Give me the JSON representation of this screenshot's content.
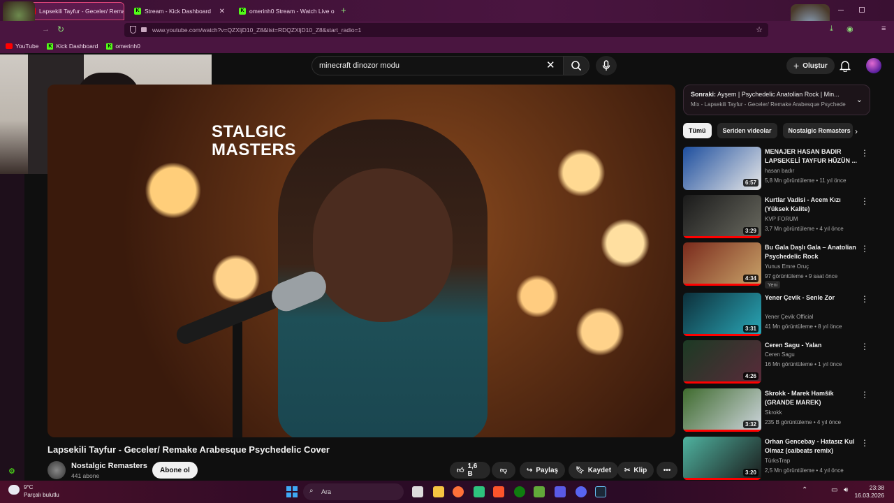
{
  "browser": {
    "tabs": [
      {
        "label": "Lapsekili Tayfur - Geceler/ Remake",
        "close": "✕",
        "favicon_color": "#ff0000"
      },
      {
        "label": "Stream - Kick Dashboard",
        "close": "✕",
        "favicon_color": "#53fc18"
      },
      {
        "label": "omerinh0 Stream - Watch Live o",
        "close": "✕",
        "favicon_color": "#53fc18"
      }
    ],
    "new_tab": "+",
    "url": "www.youtube.com/watch?v=QZXljD10_Z8&list=RDQZXljD10_Z8&start_radio=1",
    "bookmarks": [
      "YouTube",
      "Kick Dashboard",
      "omerinh0"
    ]
  },
  "header": {
    "search_value": "minecraft dinozor modu",
    "create_label": "Oluştur"
  },
  "video": {
    "overlay_line1": "STALGIC",
    "overlay_line2": "MASTERS",
    "title": "Lapsekili Tayfur - Geceler/ Remake Arabesque Psychedelic Cover"
  },
  "channel": {
    "name": "Nostalgic Remasters",
    "subs": "441 abone",
    "subscribe_label": "Abone ol"
  },
  "actions": {
    "likes": "1,6 B",
    "share": "Paylaş",
    "save": "Kaydet",
    "clip": "Klip",
    "more": "•••"
  },
  "up_next": {
    "prefix": "Sonraki:",
    "title": "Ayşem | Psychedelic Anatolian Rock | Min...",
    "mix": "Mix - Lapsekili Tayfur - Geceler/ Remake  Arabesque Psychede"
  },
  "chips": [
    "Tümü",
    "Seriden videolar",
    "Nostalgic Remasters"
  ],
  "recommendations": [
    {
      "title": "MENAJER HASAN BADIR LAPSEKELİ TAYFUR HÜZÜN ...",
      "channel": "hasan badır",
      "meta": "5,8 Mn görüntüleme • 11 yıl önce",
      "duration": "6:57",
      "color1": "#1d4e9e",
      "color2": "#e8e8e8",
      "progress": 0.0
    },
    {
      "title": "Kurtlar Vadisi - Acem Kızı (Yüksek Kalite)",
      "channel": "KVP FORUM",
      "meta": "3,7 Mn görüntüleme • 4 yıl önce",
      "duration": "3:29",
      "color1": "#1a1a1a",
      "color2": "#6a6a60",
      "progress": 1.0
    },
    {
      "title": "Bu Gala Daşlı Gala – Anatolian Psychedelic Rock (Azerbaijani...",
      "channel": "Yunus Emre Oruç",
      "meta": "97 görüntüleme • 9 saat önce",
      "badge": "Yeni",
      "duration": "4:34",
      "color1": "#7a2a1c",
      "color2": "#c9a46a",
      "progress": 1.0
    },
    {
      "title": "Yener Çevik - Senle Zor",
      "channel": "Yener Çevik Official",
      "meta": "41 Mn görüntüleme • 8 yıl önce",
      "duration": "3:31",
      "color1": "#0d2f3a",
      "color2": "#2aa8b8",
      "progress": 1.0
    },
    {
      "title": "Ceren Sagu - Yalan",
      "channel": "Ceren Sagu",
      "meta": "16 Mn görüntüleme • 1 yıl önce",
      "duration": "4:26",
      "color1": "#1c3a24",
      "color2": "#5a2a3a",
      "progress": 1.0
    },
    {
      "title": "Skrokk - Marek Hamšík (GRANDE MAREK)",
      "channel": "Skrokk",
      "meta": "235 B görüntüleme • 4 yıl önce",
      "duration": "3:32",
      "color1": "#3f6b2e",
      "color2": "#cfd6de",
      "progress": 1.0
    },
    {
      "title": "Orhan Gencebay - Hatasız Kul Olmaz (caibeats remix)",
      "channel": "TürksTrap",
      "meta": "2,5 Mn görüntüleme • 4 yıl önce",
      "duration": "3:20",
      "color1": "#4fb3a0",
      "color2": "#1a1a1a",
      "progress": 1.0
    }
  ],
  "taskbar": {
    "temp": "9°C",
    "weather": "Parçalı bulutlu",
    "search": "Ara",
    "time": "23:38",
    "date": "16.03.2026"
  }
}
